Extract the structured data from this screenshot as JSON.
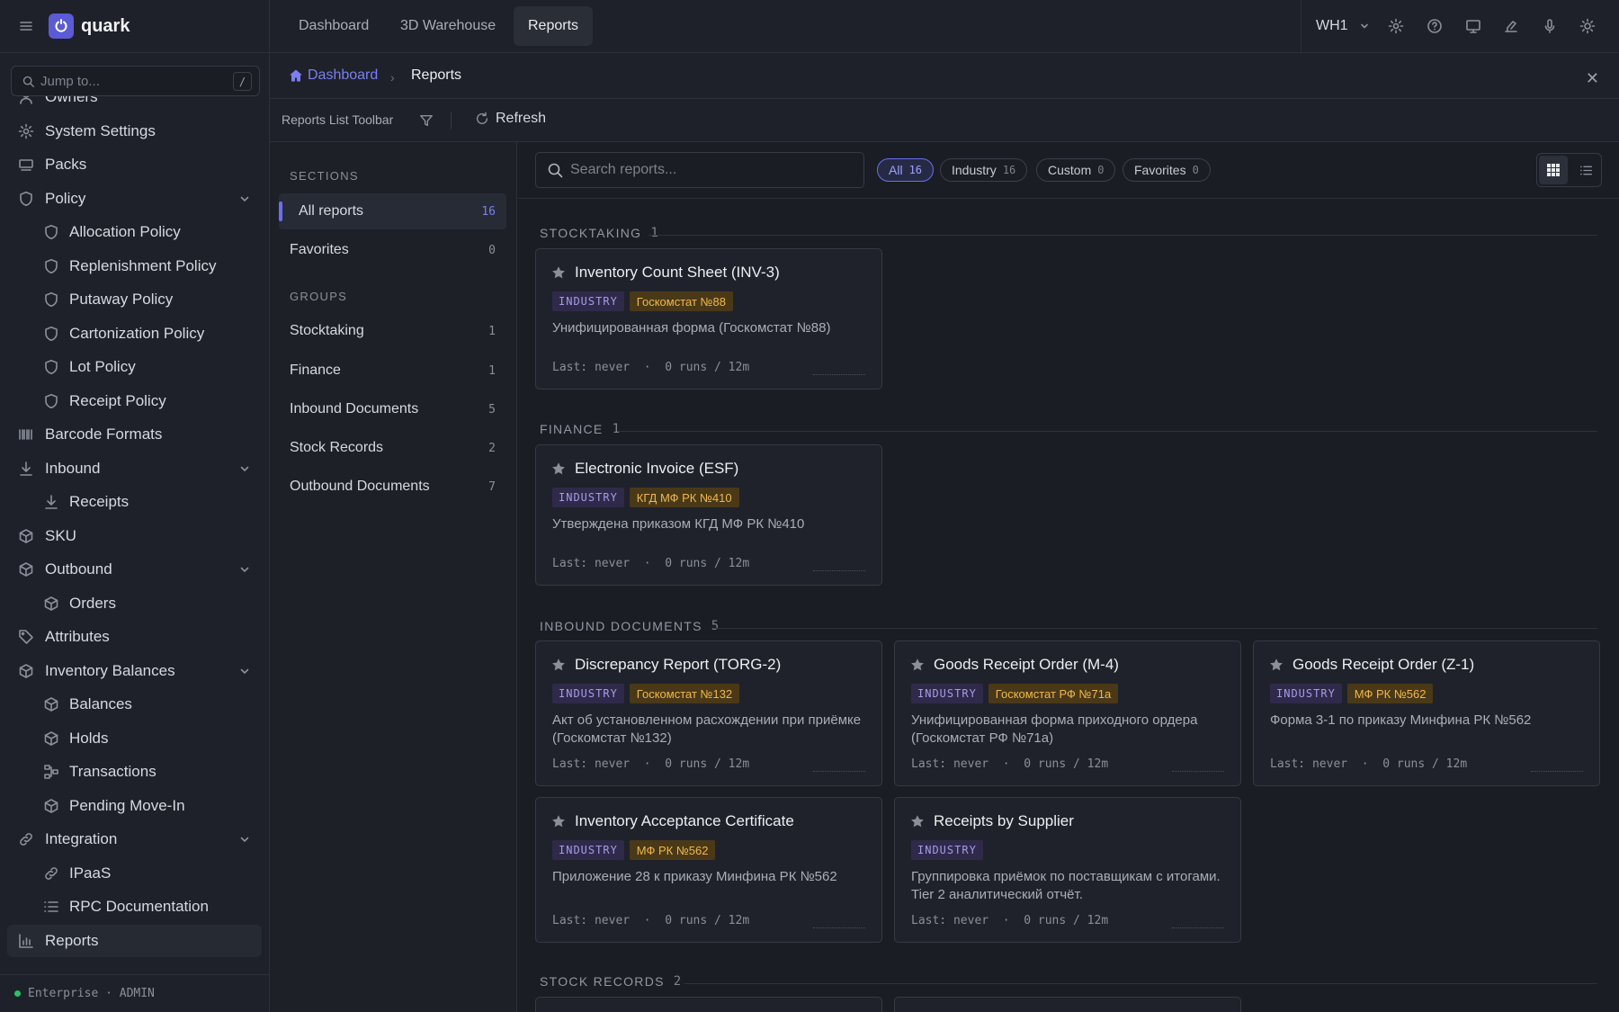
{
  "app": {
    "name": "quark",
    "jump_placeholder": "Jump to...",
    "jump_shortcut": "/",
    "footer": "Enterprise · ADMIN"
  },
  "sidebar": {
    "items": [
      {
        "label": "Owners",
        "icon": "user-icon",
        "level": 0
      },
      {
        "label": "System Settings",
        "icon": "gear-icon",
        "level": 0
      },
      {
        "label": "Packs",
        "icon": "truck-icon",
        "level": 0
      },
      {
        "label": "Policy",
        "icon": "shield-icon",
        "level": 0,
        "expandable": true
      },
      {
        "label": "Allocation Policy",
        "icon": "shield-icon",
        "level": 1
      },
      {
        "label": "Replenishment Policy",
        "icon": "shield-icon",
        "level": 1
      },
      {
        "label": "Putaway Policy",
        "icon": "shield-icon",
        "level": 1
      },
      {
        "label": "Cartonization Policy",
        "icon": "shield-icon",
        "level": 1
      },
      {
        "label": "Lot Policy",
        "icon": "shield-icon",
        "level": 1
      },
      {
        "label": "Receipt Policy",
        "icon": "shield-icon",
        "level": 1
      },
      {
        "label": "Barcode Formats",
        "icon": "barcode-icon",
        "level": 0
      },
      {
        "label": "Inbound",
        "icon": "arrow-down-icon",
        "level": 0,
        "expandable": true
      },
      {
        "label": "Receipts",
        "icon": "arrow-down-icon",
        "level": 1
      },
      {
        "label": "SKU",
        "icon": "box-icon",
        "level": 0
      },
      {
        "label": "Outbound",
        "icon": "box-icon",
        "level": 0,
        "expandable": true
      },
      {
        "label": "Orders",
        "icon": "box-icon",
        "level": 1
      },
      {
        "label": "Attributes",
        "icon": "tag-icon",
        "level": 0
      },
      {
        "label": "Inventory Balances",
        "icon": "box-icon",
        "level": 0,
        "expandable": true
      },
      {
        "label": "Balances",
        "icon": "box-icon",
        "level": 1
      },
      {
        "label": "Holds",
        "icon": "box-icon",
        "level": 1
      },
      {
        "label": "Transactions",
        "icon": "flow-icon",
        "level": 1
      },
      {
        "label": "Pending Move-In",
        "icon": "box-icon",
        "level": 1
      },
      {
        "label": "Integration",
        "icon": "link-icon",
        "level": 0,
        "expandable": true
      },
      {
        "label": "IPaaS",
        "icon": "link-icon",
        "level": 1
      },
      {
        "label": "RPC Documentation",
        "icon": "list-icon",
        "level": 1
      },
      {
        "label": "Reports",
        "icon": "chart-icon",
        "level": 0,
        "active": true
      }
    ]
  },
  "topbar": {
    "tabs": [
      {
        "label": "Dashboard"
      },
      {
        "label": "3D Warehouse"
      },
      {
        "label": "Reports",
        "active": true
      }
    ],
    "warehouse": "WH1",
    "icons": [
      "gear-icon",
      "help-icon",
      "monitor-icon",
      "scanner-icon",
      "mic-icon",
      "sun-icon"
    ]
  },
  "breadcrumb": {
    "home": "Dashboard",
    "current": "Reports"
  },
  "toolbar": {
    "label": "Reports List Toolbar",
    "refresh": "Refresh"
  },
  "sections": {
    "heading": "SECTIONS",
    "items": [
      {
        "label": "All reports",
        "count": "16",
        "active": true
      },
      {
        "label": "Favorites",
        "count": "0"
      }
    ],
    "groups_heading": "GROUPS",
    "groups": [
      {
        "label": "Stocktaking",
        "count": "1"
      },
      {
        "label": "Finance",
        "count": "1"
      },
      {
        "label": "Inbound Documents",
        "count": "5"
      },
      {
        "label": "Stock Records",
        "count": "2"
      },
      {
        "label": "Outbound Documents",
        "count": "7"
      }
    ]
  },
  "search": {
    "placeholder": "Search reports..."
  },
  "filters": [
    {
      "label": "All",
      "count": "16",
      "active": true
    },
    {
      "label": "Industry",
      "count": "16"
    },
    {
      "label": "Custom",
      "count": "0"
    },
    {
      "label": "Favorites",
      "count": "0"
    }
  ],
  "groups": [
    {
      "title": "STOCKTAKING",
      "count": "1",
      "cards": [
        {
          "title": "Inventory Count Sheet (INV-3)",
          "tag": "INDUSTRY",
          "source": "Госкомстат №88",
          "desc": "Унифицированная форма (Госкомстат №88)",
          "meta": "Last: never  ·  0 runs / 12m"
        }
      ]
    },
    {
      "title": "FINANCE",
      "count": "1",
      "cards": [
        {
          "title": "Electronic Invoice (ESF)",
          "tag": "INDUSTRY",
          "source": "КГД МФ РК №410",
          "desc": "Утверждена приказом КГД МФ РК №410",
          "meta": "Last: never  ·  0 runs / 12m"
        }
      ]
    },
    {
      "title": "INBOUND DOCUMENTS",
      "count": "5",
      "cards": [
        {
          "title": "Discrepancy Report (TORG-2)",
          "tag": "INDUSTRY",
          "source": "Госкомстат №132",
          "desc": "Акт об установленном расхождении при приёмке (Госкомстат №132)",
          "meta": "Last: never  ·  0 runs / 12m"
        },
        {
          "title": "Goods Receipt Order (M-4)",
          "tag": "INDUSTRY",
          "source": "Госкомстат РФ №71а",
          "desc": "Унифицированная форма приходного ордера (Госкомстат РФ №71а)",
          "meta": "Last: never  ·  0 runs / 12m"
        },
        {
          "title": "Goods Receipt Order (Z-1)",
          "tag": "INDUSTRY",
          "source": "МФ РК №562",
          "desc": "Форма 3-1 по приказу Минфина РК №562",
          "meta": "Last: never  ·  0 runs / 12m"
        },
        {
          "title": "Inventory Acceptance Certificate",
          "tag": "INDUSTRY",
          "source": "МФ РК №562",
          "desc": "Приложение 28 к приказу Минфина РК №562",
          "meta": "Last: never  ·  0 runs / 12m"
        },
        {
          "title": "Receipts by Supplier",
          "tag": "INDUSTRY",
          "source": "",
          "desc": "Группировка приёмок по поставщикам с итогами. Tier 2 аналитический отчёт.",
          "meta": "Last: never  ·  0 runs / 12m"
        }
      ]
    },
    {
      "title": "STOCK RECORDS",
      "count": "2",
      "cards": []
    }
  ]
}
